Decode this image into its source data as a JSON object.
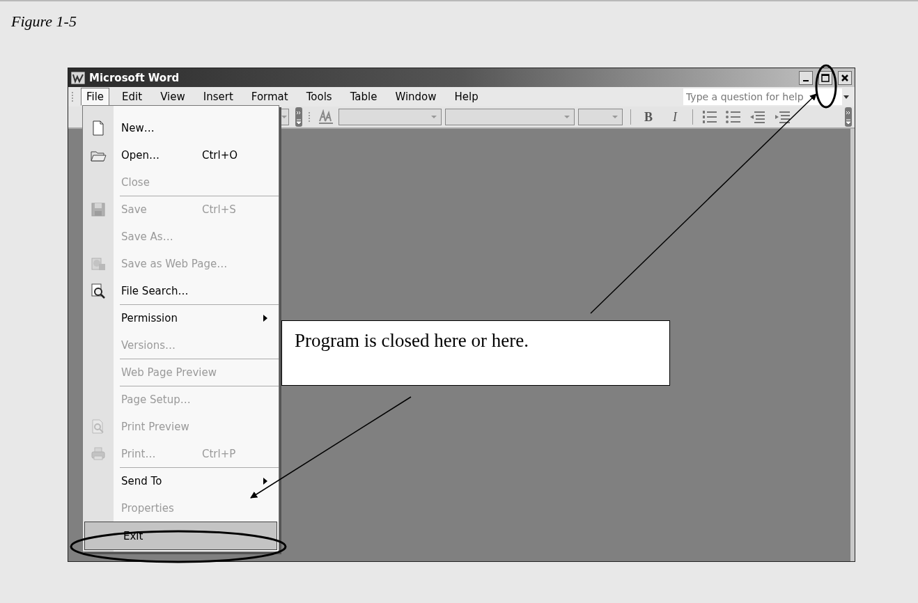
{
  "caption": "Figure 1-5",
  "window": {
    "title": "Microsoft Word"
  },
  "menu_bar": [
    {
      "label": "File",
      "selected": true
    },
    {
      "label": "Edit",
      "selected": false
    },
    {
      "label": "View",
      "selected": false
    },
    {
      "label": "Insert",
      "selected": false
    },
    {
      "label": "Format",
      "selected": false
    },
    {
      "label": "Tools",
      "selected": false
    },
    {
      "label": "Table",
      "selected": false
    },
    {
      "label": "Window",
      "selected": false
    },
    {
      "label": "Help",
      "selected": false
    }
  ],
  "help_box": {
    "placeholder": "Type a question for help"
  },
  "toolbar": {
    "buttons": [
      {
        "label": "B",
        "kind": "bold"
      },
      {
        "label": "I",
        "kind": "italic"
      }
    ]
  },
  "file_menu": [
    {
      "label": "New…",
      "disabled": false,
      "separator_before": false,
      "submenu": false,
      "selected": false
    },
    {
      "label": "Open…",
      "shortcut": "Ctrl+O",
      "disabled": false,
      "separator_before": false,
      "submenu": false,
      "selected": false
    },
    {
      "label": "Close",
      "disabled": true,
      "separator_before": false,
      "submenu": false,
      "selected": false
    },
    {
      "label": "Save",
      "shortcut": "Ctrl+S",
      "disabled": true,
      "separator_before": true,
      "submenu": false,
      "selected": false
    },
    {
      "label": "Save As…",
      "disabled": true,
      "separator_before": false,
      "submenu": false,
      "selected": false
    },
    {
      "label": "Save as Web Page…",
      "disabled": true,
      "separator_before": false,
      "submenu": false,
      "selected": false
    },
    {
      "label": "File Search…",
      "disabled": false,
      "separator_before": false,
      "submenu": false,
      "selected": false
    },
    {
      "label": "Permission",
      "disabled": false,
      "separator_before": true,
      "submenu": true,
      "selected": false
    },
    {
      "label": "Versions…",
      "disabled": true,
      "separator_before": false,
      "submenu": false,
      "selected": false
    },
    {
      "label": "Web Page Preview",
      "disabled": true,
      "separator_before": true,
      "submenu": false,
      "selected": false
    },
    {
      "label": "Page Setup…",
      "disabled": true,
      "separator_before": true,
      "submenu": false,
      "selected": false
    },
    {
      "label": "Print Preview",
      "disabled": true,
      "separator_before": false,
      "submenu": false,
      "selected": false
    },
    {
      "label": "Print…",
      "shortcut": "Ctrl+P",
      "disabled": true,
      "separator_before": false,
      "submenu": false,
      "selected": false
    },
    {
      "label": "Send To",
      "disabled": false,
      "separator_before": true,
      "submenu": true,
      "selected": false
    },
    {
      "label": "Properties",
      "disabled": true,
      "separator_before": false,
      "submenu": false,
      "selected": false
    },
    {
      "label": "Exit",
      "disabled": false,
      "separator_before": false,
      "submenu": false,
      "selected": true
    }
  ],
  "callout": {
    "text": "Program is closed here or here."
  }
}
